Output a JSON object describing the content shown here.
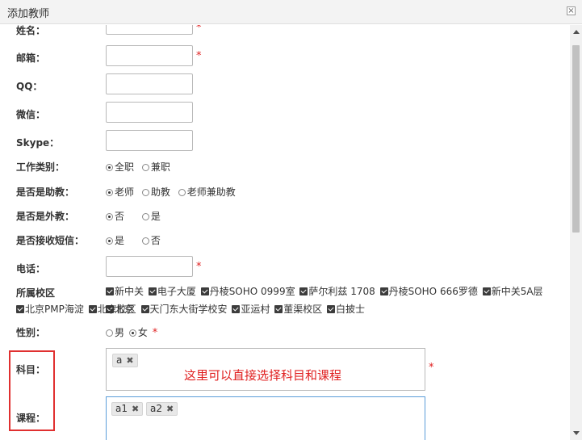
{
  "dialog": {
    "title": "添加教师",
    "close_glyph": "×"
  },
  "fields": {
    "name": {
      "label": "姓名：",
      "value": "",
      "required": "*"
    },
    "email": {
      "label": "邮箱：",
      "value": "",
      "required": "*"
    },
    "qq": {
      "label": "QQ：",
      "value": ""
    },
    "wechat": {
      "label": "微信：",
      "value": ""
    },
    "skype": {
      "label": "Skype：",
      "value": ""
    },
    "job_type": {
      "label": "工作类别：",
      "options": [
        "全职",
        "兼职"
      ],
      "selected": "全职"
    },
    "assistant": {
      "label": "是否是助教：",
      "options": [
        "老师",
        "助教",
        "老师兼助教"
      ],
      "selected": "老师"
    },
    "foreign": {
      "label": "是否是外教：",
      "options": [
        "否",
        "是"
      ],
      "selected": "否"
    },
    "sms": {
      "label": "是否接收短信：",
      "options": [
        "是",
        "否"
      ],
      "selected": "是"
    },
    "phone": {
      "label": "电话：",
      "value": "",
      "required": "*"
    },
    "campus": {
      "label": "所属校区",
      "options": [
        "新中关",
        "电子大厦",
        "丹棱SOHO 0999室",
        "萨尔利兹 1708",
        "丹棱SOHO 666罗德",
        "新中关5A层",
        "北京",
        "北京PMP海淀",
        "北京校区",
        "天门东大街学校安",
        "亚运村",
        "董渠校区",
        "白披士"
      ],
      "checked": true
    },
    "gender": {
      "label": "性别：",
      "options": [
        "男",
        "女"
      ],
      "selected": "女",
      "required": "*"
    },
    "subject": {
      "label": "科目：",
      "tags": [
        "a"
      ],
      "required": "*"
    },
    "course": {
      "label": "课程：",
      "tags": [
        "a1",
        "a2"
      ]
    }
  },
  "annotation": {
    "text": "这里可以直接选择科目和课程"
  },
  "colors": {
    "required": "#e02020",
    "highlight": "#e03030",
    "focus": "#5b9dd9"
  }
}
